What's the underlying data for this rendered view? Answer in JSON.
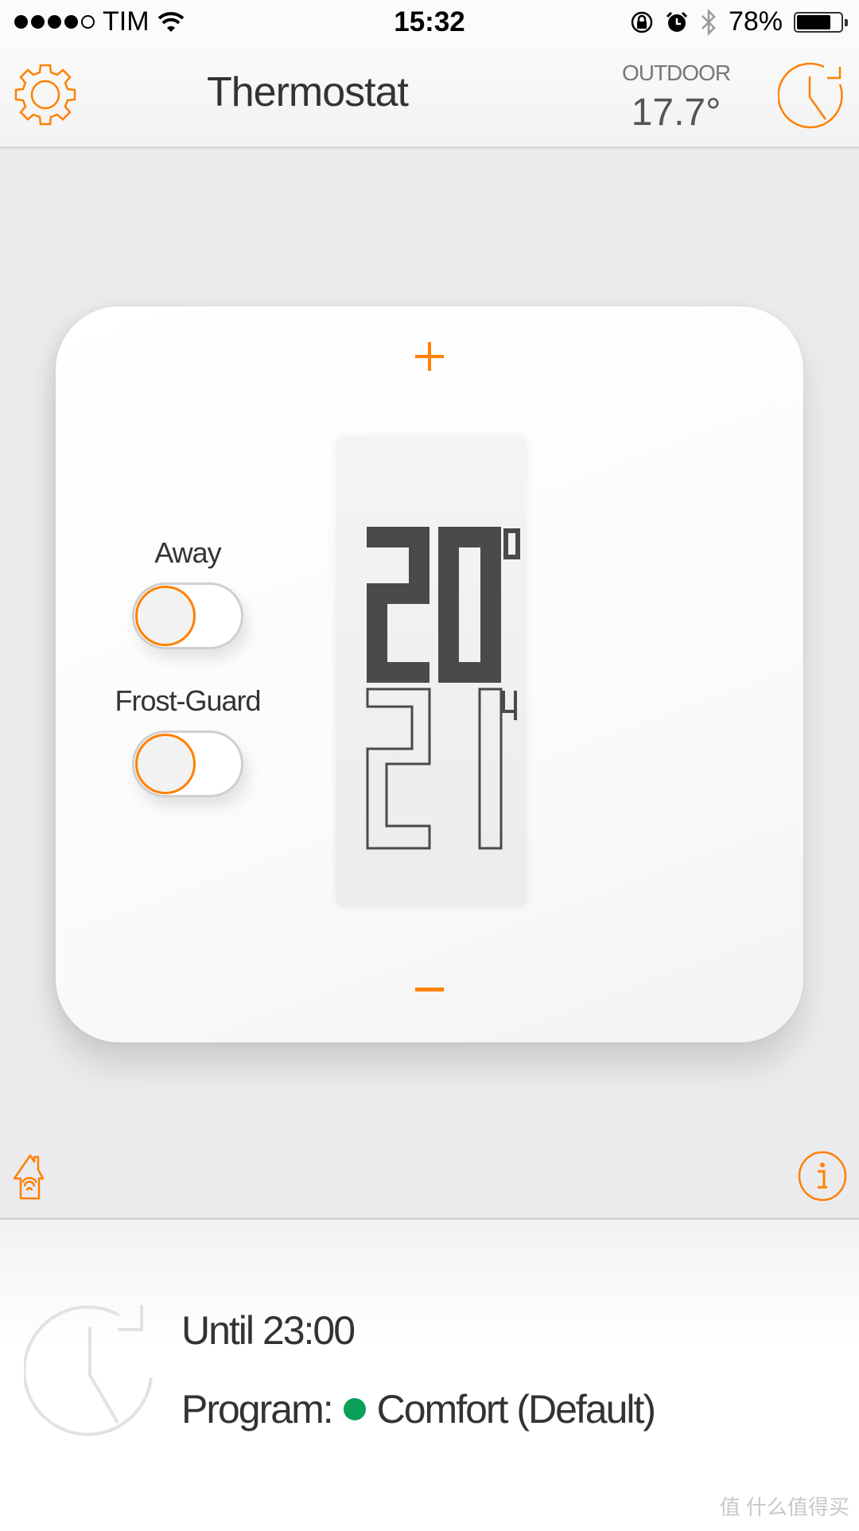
{
  "status_bar": {
    "signal_bars_filled": 4,
    "signal_bars_total": 5,
    "carrier": "TIM",
    "time": "15:32",
    "battery_percent_label": "78%",
    "battery_level": 0.78,
    "icons": [
      "wifi-icon",
      "rotation-lock-icon",
      "alarm-icon",
      "bluetooth-icon",
      "battery-icon"
    ]
  },
  "nav": {
    "title": "Thermostat",
    "outdoor_label": "OUTDOOR",
    "outdoor_temp": "17.7°",
    "left_icon": "gear-icon",
    "right_icon": "schedule-clock-icon"
  },
  "thermostat": {
    "current_temp": "20",
    "current_temp_decimal": "0",
    "setpoint_temp": "21",
    "setpoint_decimal": "4",
    "increase_icon": "plus-icon",
    "decrease_icon": "minus-icon"
  },
  "toggles": [
    {
      "label": "Away",
      "on": false
    },
    {
      "label": "Frost-Guard",
      "on": false
    }
  ],
  "footer_icons": {
    "left": "home-wifi-icon",
    "right": "info-icon"
  },
  "schedule": {
    "until": "Until 23:00",
    "program_label": "Program:",
    "program_name": "Comfort (Default)",
    "program_color": "#0aa05a"
  },
  "colors": {
    "accent": "#ff8000",
    "lcd_digit": "#4a4a4a"
  },
  "watermark": "值 什么值得买"
}
